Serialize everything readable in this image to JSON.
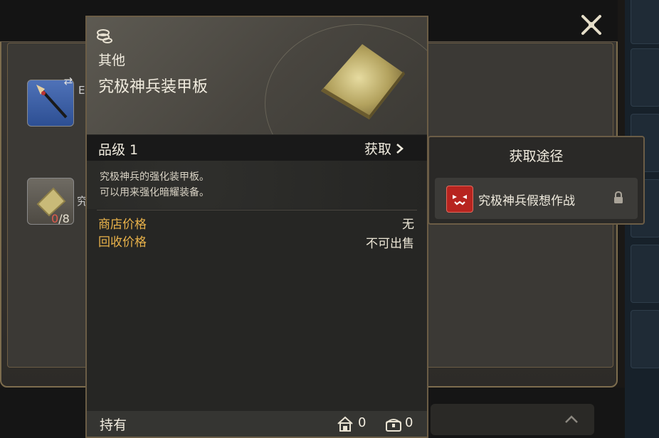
{
  "item": {
    "category": "其他",
    "name": "究极神兵装甲板",
    "grade_label": "品级 1",
    "acquire_label": "获取",
    "description": [
      "究极神兵的强化装甲板。",
      "可以用来强化暗耀装备。"
    ],
    "prices": [
      {
        "label": "商店价格",
        "value": "无"
      },
      {
        "label": "回收价格",
        "value": "不可出售"
      }
    ],
    "footer": {
      "hold_label": "持有",
      "house_count": "0",
      "chest_count": "0"
    }
  },
  "popup": {
    "title": "获取途径",
    "sources": [
      {
        "label": "究极神兵假想作战",
        "icon": "duty-roulette-icon",
        "locked": true
      }
    ]
  },
  "background_list": {
    "count_owned": "0",
    "count_total": "/8",
    "name_fragment_1": "E",
    "name_fragment_2": "究"
  },
  "colors": {
    "price_label": "#e9b24a",
    "count_red": "#e05b4e",
    "frame_gold": "#6b5d46"
  }
}
